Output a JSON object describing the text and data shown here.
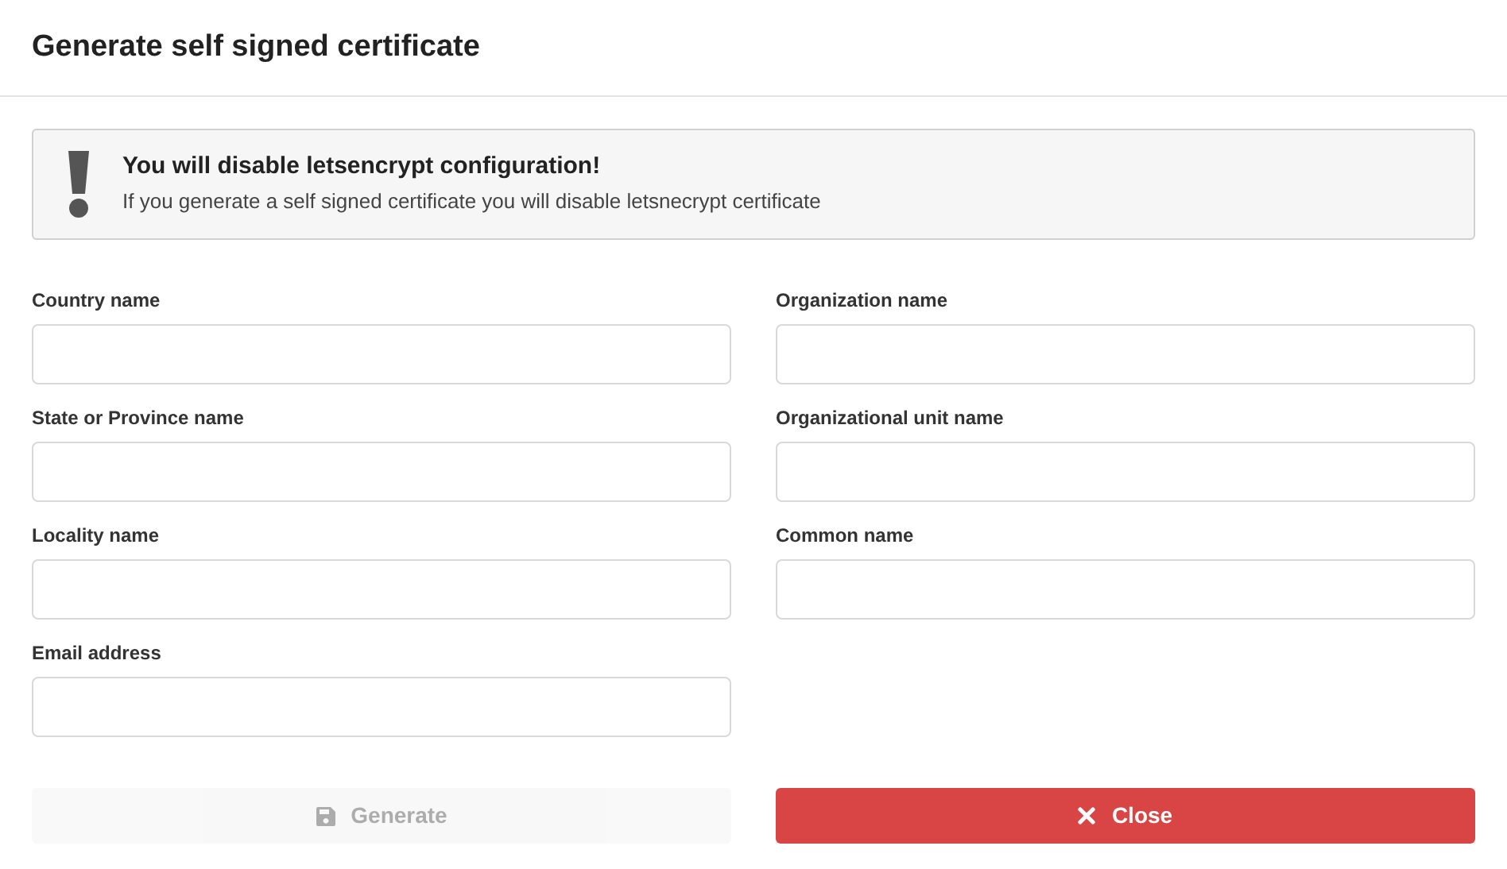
{
  "dialog": {
    "title": "Generate self signed certificate"
  },
  "alert": {
    "title": "You will disable letsencrypt configuration!",
    "message": "If you generate a self signed certificate you will disable letsnecrypt certificate"
  },
  "left_fields": [
    {
      "label": "Country name"
    },
    {
      "label": "State or Province name"
    },
    {
      "label": "Locality name"
    },
    {
      "label": "Email address"
    }
  ],
  "right_fields": [
    {
      "label": "Organization name"
    },
    {
      "label": "Organizational unit name"
    },
    {
      "label": "Common name"
    }
  ],
  "buttons": [
    {
      "kind": "generate",
      "label": "Generate",
      "disabled": true
    },
    {
      "kind": "close",
      "label": "Close",
      "disabled": false
    }
  ]
}
